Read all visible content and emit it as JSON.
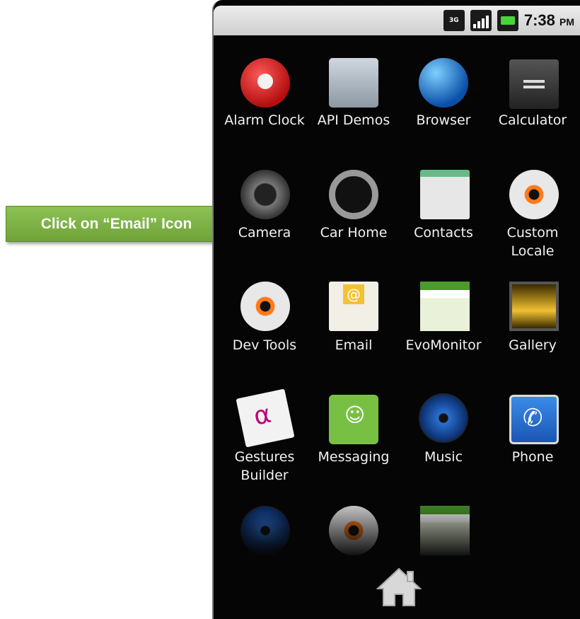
{
  "callout": {
    "text": "Click on “Email” Icon"
  },
  "status_bar": {
    "network": "3G",
    "time": "7:38",
    "ampm": "PM"
  },
  "apps": [
    {
      "label": "Alarm Clock",
      "icon": "alarm-clock-icon"
    },
    {
      "label": "API Demos",
      "icon": "folder-gear-icon"
    },
    {
      "label": "Browser",
      "icon": "globe-icon"
    },
    {
      "label": "Calculator",
      "icon": "calculator-icon"
    },
    {
      "label": "Camera",
      "icon": "camera-icon"
    },
    {
      "label": "Car Home",
      "icon": "steering-wheel-icon"
    },
    {
      "label": "Contacts",
      "icon": "contacts-icon"
    },
    {
      "label": "Custom\nLocale",
      "icon": "gear-icon"
    },
    {
      "label": "Dev Tools",
      "icon": "gear-icon"
    },
    {
      "label": "Email",
      "icon": "email-icon"
    },
    {
      "label": "EvoMonitor",
      "icon": "android-icon"
    },
    {
      "label": "Gallery",
      "icon": "gallery-icon"
    },
    {
      "label": "Gestures\nBuilder",
      "icon": "gestures-icon"
    },
    {
      "label": "Messaging",
      "icon": "messaging-icon"
    },
    {
      "label": "Music",
      "icon": "music-icon"
    },
    {
      "label": "Phone",
      "icon": "phone-icon"
    }
  ],
  "home": {
    "icon": "home-icon"
  }
}
